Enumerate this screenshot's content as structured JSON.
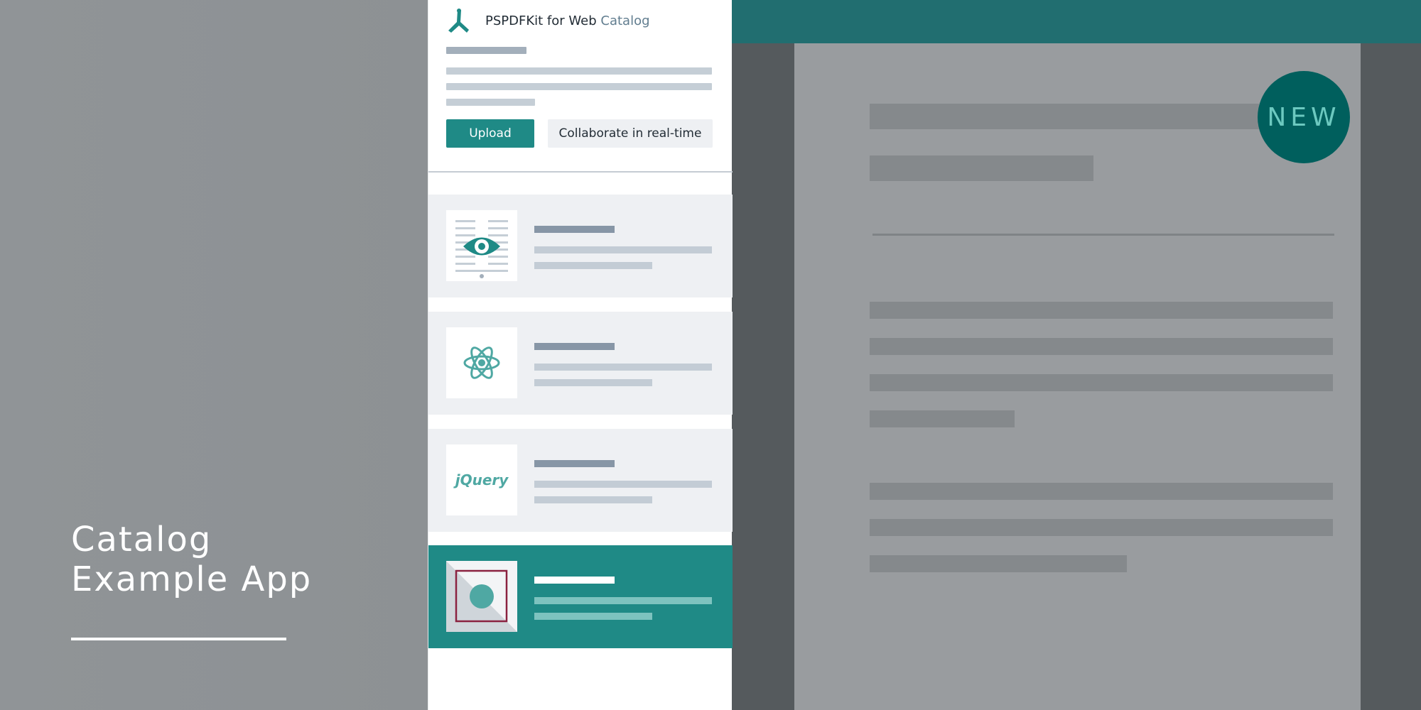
{
  "hero": {
    "title_line1": "Catalog",
    "title_line2": "Example App"
  },
  "panel": {
    "brand_name": "PSPDFKit for Web",
    "brand_accent": "Catalog",
    "upload_label": "Upload",
    "collaborate_label": "Collaborate in real-time",
    "items": [
      {
        "icon": "eye-document-icon",
        "active": false
      },
      {
        "icon": "react-icon",
        "active": false
      },
      {
        "icon": "jquery-logo",
        "label": "jQuery",
        "active": false
      },
      {
        "icon": "image-annotation-icon",
        "active": true
      }
    ]
  },
  "viewer": {
    "badge": "NEW"
  },
  "colors": {
    "accent": "#1f8a86",
    "toolbar": "#216e70",
    "badge": "#005f5d"
  }
}
